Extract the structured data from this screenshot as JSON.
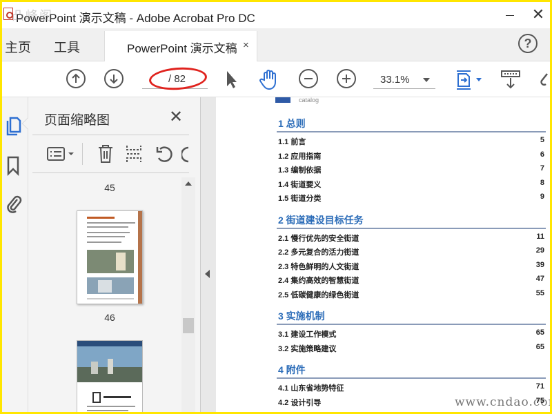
{
  "window": {
    "title": "PowerPoint 演示文稿 - Adobe Acrobat Pro DC",
    "watermark_top": "凸峰阁",
    "close_glyph": "✕"
  },
  "tabs": {
    "home": "主页",
    "tools": "工具",
    "document": "PowerPoint 演示文稿",
    "document_close": "×",
    "help": "?"
  },
  "toolbar": {
    "current_page": "",
    "total_pages": "/ 82",
    "zoom": "33.1%"
  },
  "thumbnails": {
    "title": "页面缩略图",
    "close": "✕",
    "page_labels": [
      "45",
      "46"
    ]
  },
  "toc": {
    "catalog_word": "catalog",
    "sections": [
      {
        "title": "1 总则",
        "items": [
          {
            "label": "1.1 前言",
            "page": "5"
          },
          {
            "label": "1.2 应用指南",
            "page": "6"
          },
          {
            "label": "1.3 编制依据",
            "page": "7"
          },
          {
            "label": "1.4 街道要义",
            "page": "8"
          },
          {
            "label": "1.5 街道分类",
            "page": "9"
          }
        ]
      },
      {
        "title": "2 街道建设目标任务",
        "items": [
          {
            "label": "2.1 慢行优先的安全街道",
            "page": "11"
          },
          {
            "label": "2.2 多元复合的活力街道",
            "page": "29"
          },
          {
            "label": "2.3 特色鲜明的人文街道",
            "page": "39"
          },
          {
            "label": "2.4 集约高效的智慧街道",
            "page": "47"
          },
          {
            "label": "2.5 低碳健康的绿色街道",
            "page": "55"
          }
        ]
      },
      {
        "title": "3 实施机制",
        "items": [
          {
            "label": "3.1 建设工作模式",
            "page": "65"
          },
          {
            "label": "3.2 实施策略建议",
            "page": "65"
          }
        ]
      },
      {
        "title": "4 附件",
        "items": [
          {
            "label": "4.1 山东省地势特征",
            "page": "71"
          },
          {
            "label": "4.2 设计引导",
            "page": "75"
          }
        ]
      }
    ]
  },
  "watermark_bottom": "www.cndao.com",
  "colors": {
    "frame": "#ffe600",
    "section_title": "#2b6cb8",
    "annotation": "#e0231e",
    "active_tool": "#2d6fd1"
  },
  "icons": [
    "arrow-up-circle-icon",
    "arrow-down-circle-icon",
    "pointer-icon",
    "hand-icon",
    "zoom-out-icon",
    "zoom-in-icon",
    "fit-page-icon",
    "scroll-mode-icon",
    "link-icon",
    "thumbnails-icon",
    "bookmark-icon",
    "attachment-icon",
    "options-menu-icon",
    "trash-icon",
    "insert-page-icon",
    "rotate-icon"
  ]
}
